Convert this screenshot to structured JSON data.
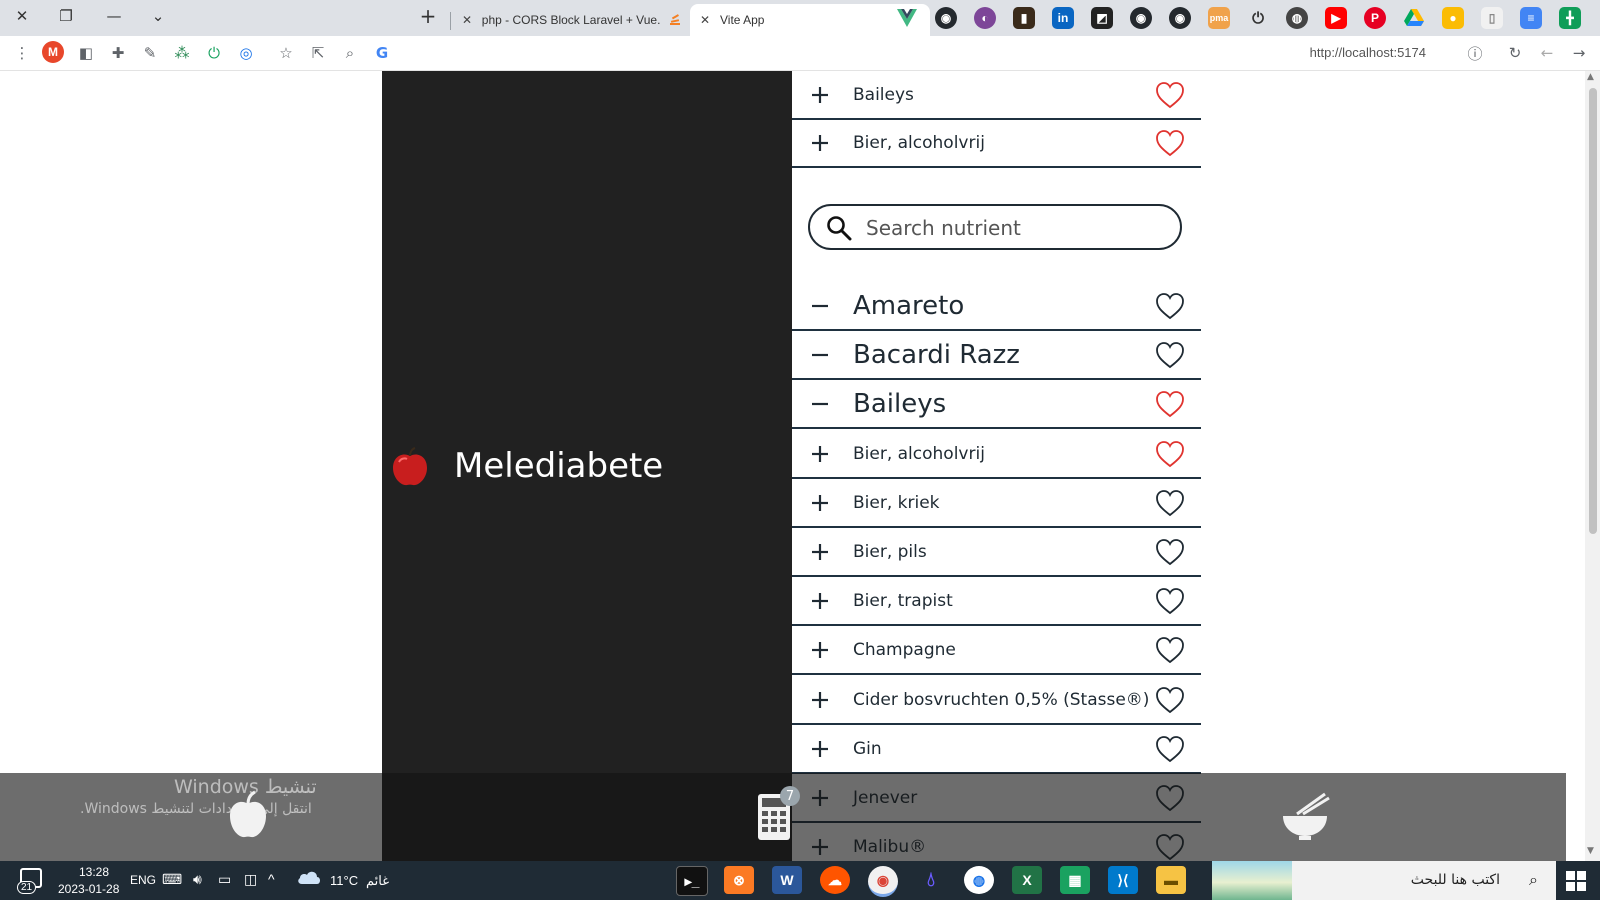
{
  "browser": {
    "tabs": [
      {
        "label": "php - CORS Block Laravel + Vue.",
        "active": false
      },
      {
        "label": "Vite App",
        "active": true
      }
    ],
    "new_tab_symbol": "+",
    "close_symbol": "✕",
    "url": "http://localhost:5174",
    "profile_initial": "M",
    "extensions": [
      "vue-icon",
      "github-icon",
      "onion-icon",
      "bookmark-icon",
      "linkedin-icon",
      "github-alt-icon",
      "github-icon",
      "github-icon",
      "pma-icon",
      "power-icon",
      "globe-icon",
      "youtube-icon",
      "pinterest-icon",
      "drive-icon",
      "keep-icon",
      "page-icon",
      "docs-icon",
      "sheets-icon"
    ]
  },
  "app": {
    "brand": "Melediabete",
    "search_placeholder": "Search nutrient",
    "top_items": [
      {
        "name": "Baileys",
        "sign": "+",
        "favorite": true
      },
      {
        "name": "Bier, alcoholvrij",
        "sign": "+",
        "favorite": true
      }
    ],
    "selected_items": [
      {
        "name": "Amareto",
        "sign": "−",
        "favorite": false
      },
      {
        "name": "Bacardi Razz",
        "sign": "−",
        "favorite": false
      },
      {
        "name": "Baileys",
        "sign": "−",
        "favorite": true
      }
    ],
    "items": [
      {
        "name": "Bier, alcoholvrij",
        "sign": "+",
        "favorite": true
      },
      {
        "name": "Bier, kriek",
        "sign": "+",
        "favorite": false
      },
      {
        "name": "Bier, pils",
        "sign": "+",
        "favorite": false
      },
      {
        "name": "Bier, trapist",
        "sign": "+",
        "favorite": false
      },
      {
        "name": "Champagne",
        "sign": "+",
        "favorite": false
      },
      {
        "name": "Cider bosvruchten 0,5% (Stasse®)",
        "sign": "+",
        "favorite": false
      },
      {
        "name": "Gin",
        "sign": "+",
        "favorite": false
      },
      {
        "name": "Jenever",
        "sign": "+",
        "favorite": false
      },
      {
        "name": "Malibu®",
        "sign": "+",
        "favorite": false
      }
    ],
    "bottom_nav": {
      "badge_count": "7"
    },
    "colors": {
      "heart_fav": "#e0332f",
      "heart_plain": "#1f2a33",
      "panel": "#212121"
    }
  },
  "windows_activation": {
    "title": "تنشيط Windows",
    "subtitle": "انتقل إلى الإعدادات لتنشيط Windows."
  },
  "taskbar": {
    "notification_count": "21",
    "time": "13:28",
    "date": "2023-01-28",
    "language": "ENG",
    "weather_temp": "11°C",
    "weather_text": "غائم",
    "search_placeholder": "اكتب هنا للبحث"
  }
}
